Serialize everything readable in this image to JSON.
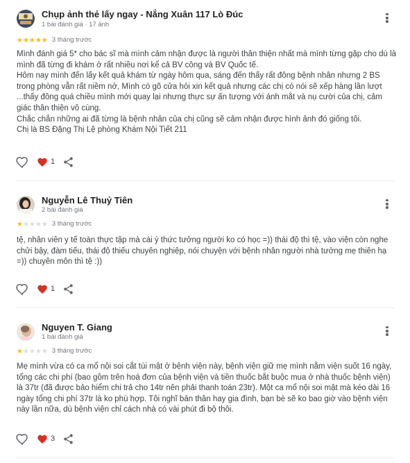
{
  "reviews": [
    {
      "name": "Chụp ảnh thẻ lấy ngay - Nắng Xuân 117 Lò Đúc",
      "meta": "1 bài đánh giá · 17 ảnh",
      "rating": 5,
      "time": "3 tháng trước",
      "paragraphs": [
        "Mình đánh giá 5* cho bác sĩ mà mình cảm nhận được là người thân thiện nhất mà mình từng gặp cho dù là mình đã từng đi khám ở rất nhiều nơi kể cả BV công và BV Quốc tế.",
        "Hôm nay mình đến lấy kết quả khám từ ngày hôm qua, sáng đến thấy rất đông bệnh nhân nhưng 2 BS trong phòng vẫn rất niềm nở, Mình có gõ cửa hỏi xin kết quả nhưng các chị có nói sẽ xếp hàng lần lượt ...thấy đông quá chiều mình mới quay lại nhưng thực sự ấn tượng với ánh mắt và nụ cười của chị, cảm giác thân thiện vô cùng.",
        "Chắc chắn những ai đã từng là bệnh nhân của chị cũng sẽ cảm nhận được hình ảnh đó giống tôi.",
        "Chị là BS Đặng Thị Lệ phòng Khám Nội Tiết 211"
      ],
      "likes": "1"
    },
    {
      "name": "Nguyễn Lê Thuỷ Tiên",
      "meta": "2 bài đánh giá",
      "rating": 1,
      "time": "3 tháng trước",
      "paragraphs": [
        "tệ, nhân viên y tế toàn thực tập mà cái ý thức tưởng người ko có học =)) thái độ thì tệ, vào viện còn nghe chửi bậy, đàm tiếu, thái độ thiếu chuyên nghiệp, nói chuyện với bệnh nhân người nhà tưởng mẹ thiên hạ =)) chuyên môn thì tệ :))"
      ],
      "likes": "1"
    },
    {
      "name": "Nguyen T. Giang",
      "meta": "1 bài đánh giá",
      "rating": 1,
      "time": "3 tháng trước",
      "paragraphs": [
        "Mẹ mình vừa có ca mổ nội soi cắt túi mật ở bệnh viện này, bệnh viện giữ mẹ mình nằm viện suốt 16 ngày, tổng các chi phí (bao gồm trên hoá đơn của bệnh viện và tiền thuốc bắt buộc mua ở nhà thuốc bệnh viện) là 37tr (đã được bảo hiểm chi trả cho 14tr nên phải thanh toán 23tr). Một ca mổ nội soi mật mà kéo dài 16 ngày tổng chi phí 37tr là ko phù hợp. Tôi nghĩ bản thân hay gia đình, bạn bè sẽ ko bao giờ vào bệnh viện này lần nữa, dù bệnh viện chỉ cách nhà có vài phút đi bộ thôi."
      ],
      "likes": "3"
    }
  ],
  "colors": {
    "star": "#fbbc04",
    "star_empty": "#dadce0",
    "heart": "#d93025",
    "icon": "#5f6368"
  },
  "icons": [
    "heart-outline-icon",
    "heart-filled-icon",
    "share-icon",
    "more-vert-icon"
  ]
}
